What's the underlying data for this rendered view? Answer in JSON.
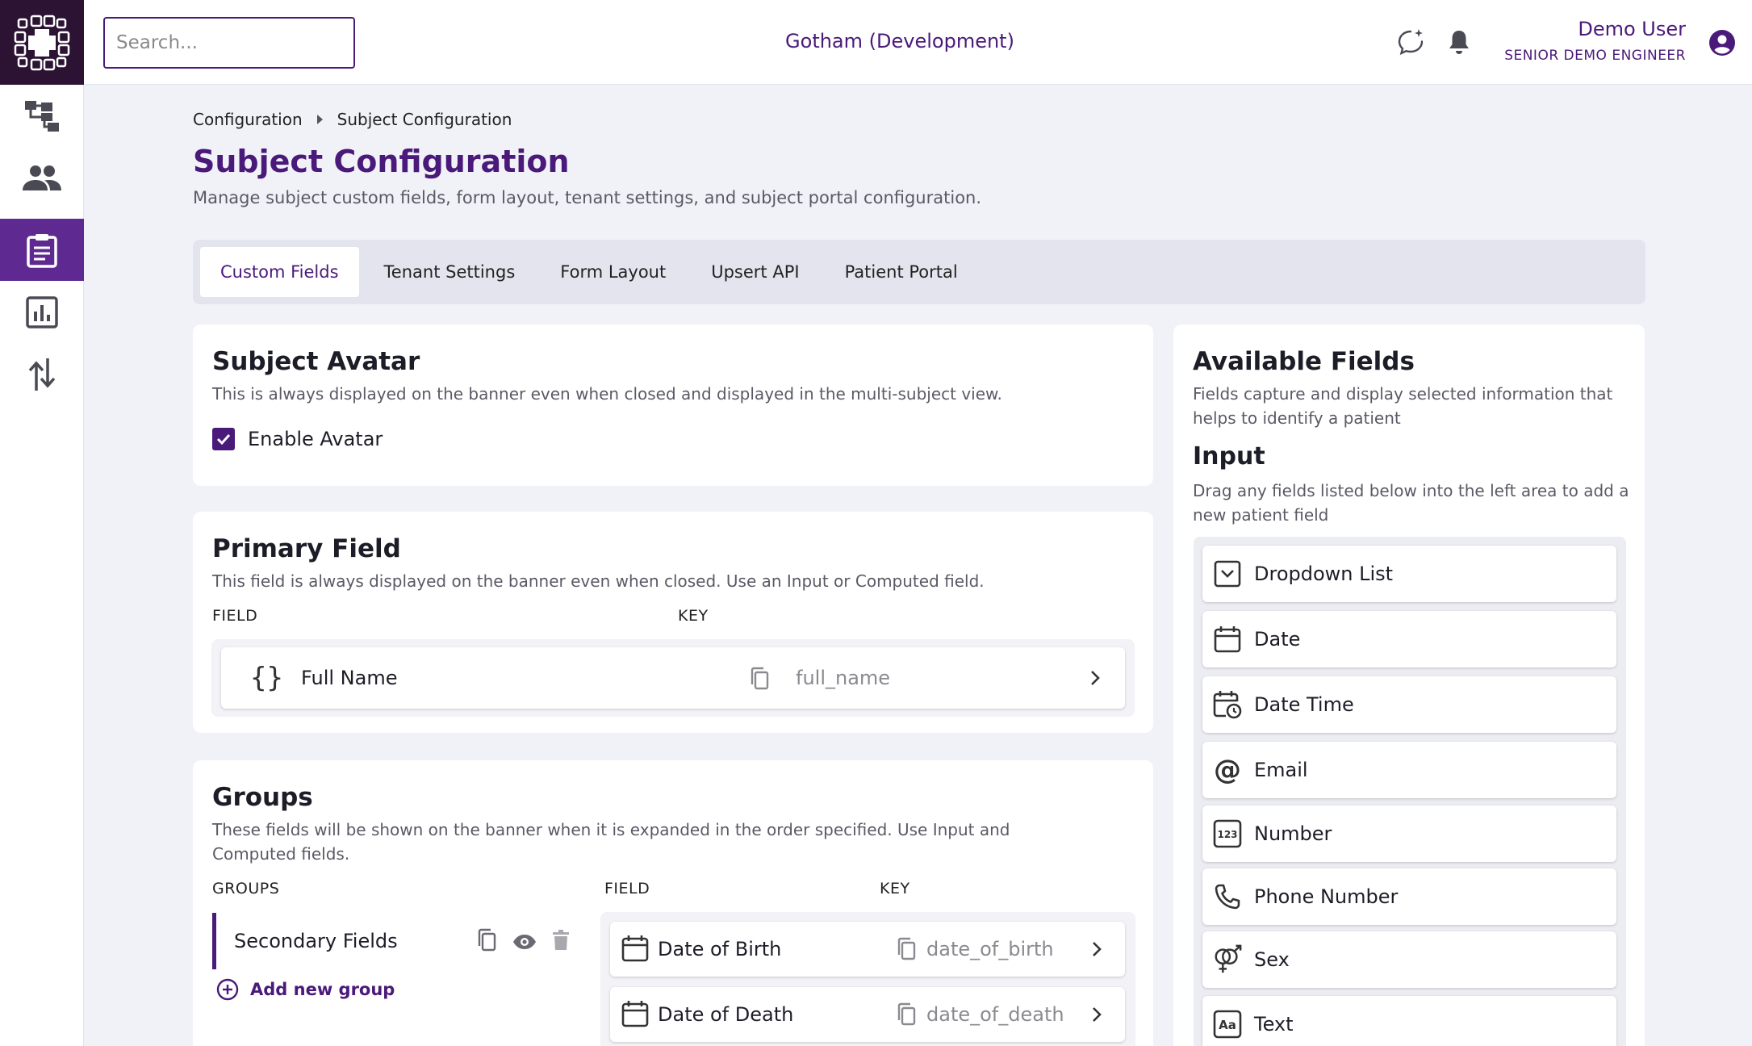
{
  "header": {
    "search_placeholder": "Search...",
    "environment": "Gotham (Development)",
    "user_name": "Demo User",
    "user_role": "SENIOR DEMO ENGINEER"
  },
  "sidebar": {
    "items": [
      {
        "name": "hierarchy",
        "active": false
      },
      {
        "name": "people",
        "active": false
      },
      {
        "name": "clipboard",
        "active": true
      },
      {
        "name": "reports",
        "active": false
      },
      {
        "name": "transfer",
        "active": false
      }
    ]
  },
  "breadcrumb": {
    "parent": "Configuration",
    "current": "Subject Configuration"
  },
  "page": {
    "title": "Subject Configuration",
    "subtitle": "Manage subject custom fields, form layout, tenant settings, and subject portal configuration."
  },
  "tabs": [
    "Custom Fields",
    "Tenant Settings",
    "Form Layout",
    "Upsert API",
    "Patient Portal"
  ],
  "active_tab": "Custom Fields",
  "subject_avatar": {
    "title": "Subject Avatar",
    "description": "This is always displayed on the banner even when closed and displayed in the multi-subject view.",
    "checkbox_label": "Enable Avatar",
    "checked": true
  },
  "primary_field": {
    "title": "Primary Field",
    "description": "This field is always displayed on the banner even when closed. Use an Input or Computed field.",
    "field_header": "FIELD",
    "key_header": "KEY",
    "field": "Full Name",
    "key": "full_name"
  },
  "groups": {
    "title": "Groups",
    "description_line1": "These fields will be shown on the banner when it is expanded in the order specified. Use Input and",
    "description_line2": "Computed fields.",
    "groups_header": "GROUPS",
    "field_header": "FIELD",
    "key_header": "KEY",
    "group_name": "Secondary Fields",
    "add_group_label": "Add new group",
    "fields": [
      {
        "field": "Date of Birth",
        "key": "date_of_birth"
      },
      {
        "field": "Date of Death",
        "key": "date_of_death"
      }
    ]
  },
  "available_fields": {
    "title": "Available Fields",
    "description_line1": "Fields capture and display selected information that",
    "description_line2": "helps to identify a patient",
    "input_title": "Input",
    "input_description_line1": "Drag any fields listed below into the left area to add a",
    "input_description_line2": "new patient field",
    "items": [
      {
        "label": "Dropdown List",
        "icon": "dropdown-icon"
      },
      {
        "label": "Date",
        "icon": "calendar-icon"
      },
      {
        "label": "Date Time",
        "icon": "calendar-clock-icon"
      },
      {
        "label": "Email",
        "icon": "at-icon"
      },
      {
        "label": "Number",
        "icon": "number-icon"
      },
      {
        "label": "Phone Number",
        "icon": "phone-icon"
      },
      {
        "label": "Sex",
        "icon": "gender-icon"
      },
      {
        "label": "Text",
        "icon": "text-icon"
      }
    ]
  },
  "colors": {
    "brand": "#4a1a7a",
    "sidebar_active": "#5e2a91",
    "logo_bg": "#2c1233"
  }
}
